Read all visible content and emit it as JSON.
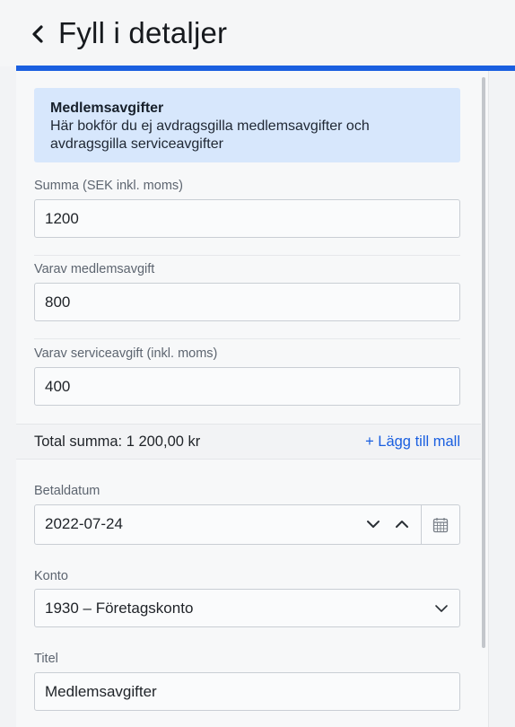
{
  "header": {
    "title": "Fyll i detaljer"
  },
  "info": {
    "title": "Medlemsavgifter",
    "description": "Här bokför du ej avdragsgilla medlemsavgifter och avdragsgilla serviceavgifter"
  },
  "fields": {
    "summa": {
      "label": "Summa (SEK inkl. moms)",
      "value": "1200"
    },
    "medlemsavgift": {
      "label": "Varav medlemsavgift",
      "value": "800"
    },
    "serviceavgift": {
      "label": "Varav serviceavgift (inkl. moms)",
      "value": "400"
    },
    "betaldatum": {
      "label": "Betaldatum",
      "value": "2022-07-24"
    },
    "konto": {
      "label": "Konto",
      "value": "1930 – Företagskonto"
    },
    "titel": {
      "label": "Titel",
      "value": "Medlemsavgifter"
    }
  },
  "total": {
    "label": "Total summa: 1 200,00 kr",
    "add_template": "+ Lägg till mall"
  },
  "colors": {
    "accent": "#1a5fe0",
    "info_bg": "#d7e7fc"
  },
  "icons": {
    "back": "chevron-left-icon",
    "decrement": "chevron-down-icon",
    "increment": "chevron-up-icon",
    "calendar": "calendar-icon",
    "select": "chevron-down-icon"
  }
}
